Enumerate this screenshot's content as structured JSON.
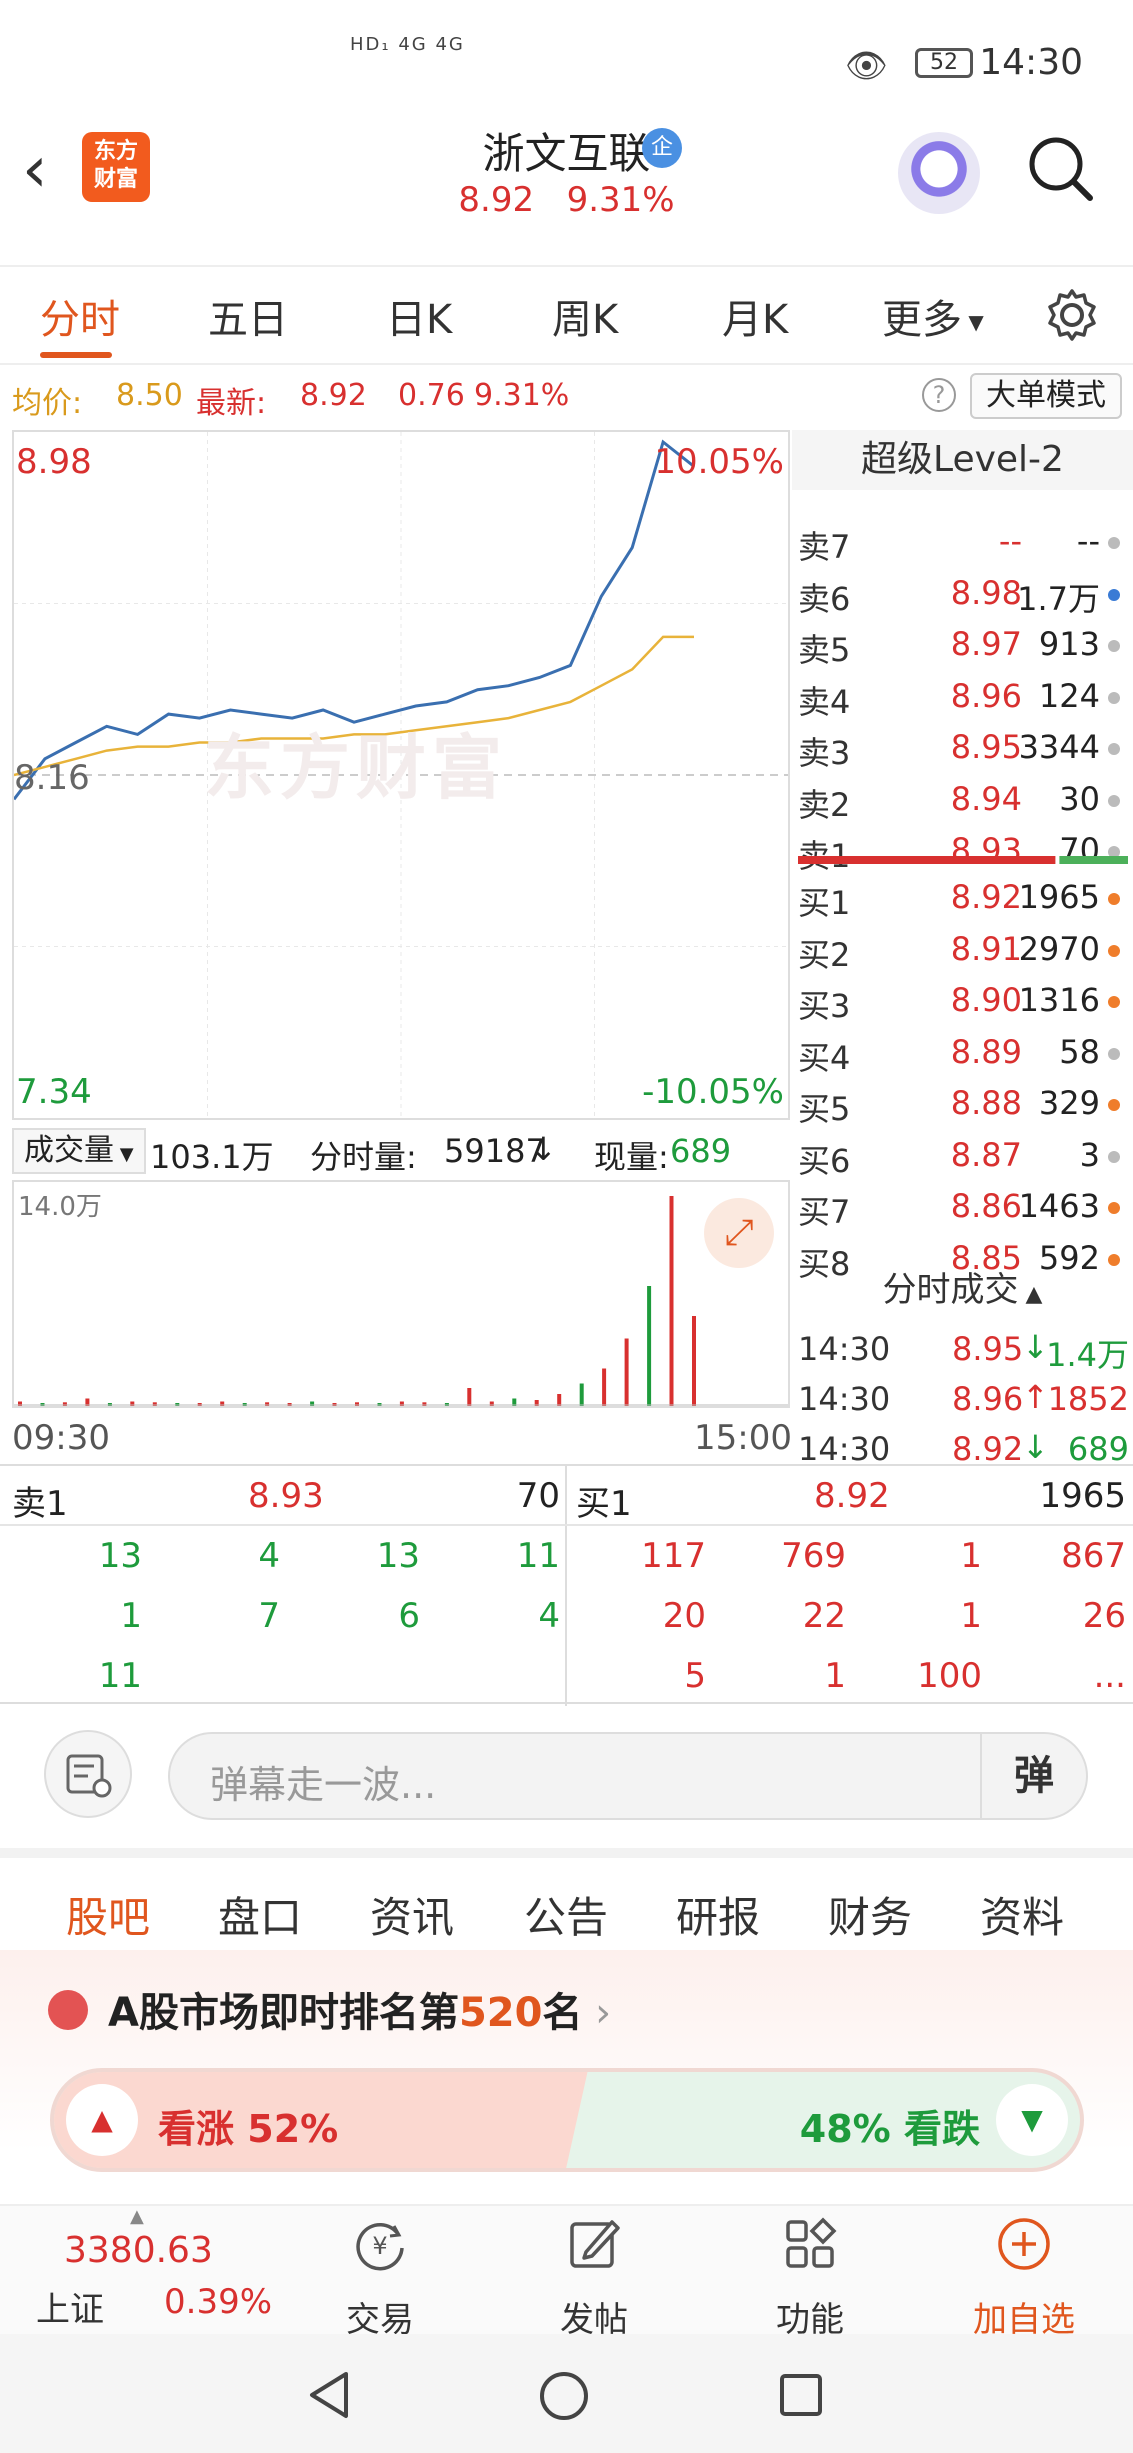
{
  "status_bar": {
    "signal_text": "HD₁ 4G 4G",
    "battery": "52",
    "time": "14:30"
  },
  "header": {
    "logo_text": "东方财富",
    "stock_name": "浙文互联",
    "badge": "企",
    "price": "8.92",
    "change_pct": "9.31%"
  },
  "tabs": [
    "分时",
    "五日",
    "日K",
    "周K",
    "月K",
    "更多"
  ],
  "info_row": {
    "avg_label": "均价:",
    "avg_value": "8.50",
    "latest_label": "最新:",
    "latest_value": "8.92",
    "change": "0.76",
    "change_pct": "9.31%",
    "help": "?",
    "big_order_mode": "大单模式"
  },
  "chart_data": {
    "type": "line",
    "series": [
      {
        "name": "最新",
        "values": [
          8.1,
          8.2,
          8.24,
          8.28,
          8.26,
          8.31,
          8.3,
          8.32,
          8.31,
          8.3,
          8.32,
          8.29,
          8.31,
          8.33,
          8.34,
          8.37,
          8.38,
          8.4,
          8.43,
          8.6,
          8.72,
          8.98,
          8.92
        ]
      },
      {
        "name": "均价",
        "values": [
          8.16,
          8.18,
          8.2,
          8.22,
          8.23,
          8.23,
          8.24,
          8.24,
          8.25,
          8.25,
          8.25,
          8.26,
          8.26,
          8.27,
          8.28,
          8.29,
          8.3,
          8.32,
          8.34,
          8.38,
          8.42,
          8.5,
          8.5
        ]
      }
    ],
    "ylim": [
      7.34,
      8.98
    ],
    "y_max_label": "8.98",
    "y_mid_label": "8.16",
    "y_min_label": "7.34",
    "pct_max_label": "10.05%",
    "pct_min_label": "-10.05%",
    "x_start": "09:30",
    "x_end": "15:00",
    "watermark": "东方财富",
    "volume": {
      "label": "成交量",
      "total": "103.1万",
      "minute_label": "分时量:",
      "minute_value": "59187",
      "current_label": "现量:",
      "current_value": "689",
      "y_max_label": "14.0万",
      "bars": [
        0.3,
        0.2,
        0.25,
        0.5,
        0.2,
        0.3,
        0.25,
        0.2,
        0.2,
        0.3,
        0.2,
        0.25,
        0.2,
        0.3,
        0.2,
        0.25,
        0.2,
        0.3,
        0.25,
        0.2,
        1.2,
        0.3,
        0.5,
        0.4,
        0.8,
        1.5,
        2.5,
        4.5,
        8,
        14,
        6
      ]
    }
  },
  "order_book": {
    "title": "超级Level-2",
    "sells": [
      {
        "label": "卖7",
        "price": "--",
        "qty": "--",
        "dot": "#bbbbbb"
      },
      {
        "label": "卖6",
        "price": "8.98",
        "qty": "1.7万",
        "dot": "#3a7bd5"
      },
      {
        "label": "卖5",
        "price": "8.97",
        "qty": "913",
        "dot": "#bbbbbb"
      },
      {
        "label": "卖4",
        "price": "8.96",
        "qty": "124",
        "dot": "#bbbbbb"
      },
      {
        "label": "卖3",
        "price": "8.95",
        "qty": "3344",
        "dot": "#bbbbbb"
      },
      {
        "label": "卖2",
        "price": "8.94",
        "qty": "30",
        "dot": "#bbbbbb"
      },
      {
        "label": "卖1",
        "price": "8.93",
        "qty": "70",
        "dot": "#bbbbbb"
      }
    ],
    "buys": [
      {
        "label": "买1",
        "price": "8.92",
        "qty": "1965",
        "dot": "#ef7d2b"
      },
      {
        "label": "买2",
        "price": "8.91",
        "qty": "2970",
        "dot": "#ef7d2b"
      },
      {
        "label": "买3",
        "price": "8.90",
        "qty": "1316",
        "dot": "#ef7d2b"
      },
      {
        "label": "买4",
        "price": "8.89",
        "qty": "58",
        "dot": "#bbbbbb"
      },
      {
        "label": "买5",
        "price": "8.88",
        "qty": "329",
        "dot": "#ef7d2b"
      },
      {
        "label": "买6",
        "price": "8.87",
        "qty": "3",
        "dot": "#bbbbbb"
      },
      {
        "label": "买7",
        "price": "8.86",
        "qty": "1463",
        "dot": "#ef7d2b"
      },
      {
        "label": "买8",
        "price": "8.85",
        "qty": "592",
        "dot": "#ef7d2b"
      }
    ],
    "buy_sell_ratio": 0.78
  },
  "ticks": {
    "title": "分时成交",
    "rows": [
      {
        "time": "14:30",
        "price": "8.95",
        "dir": "↓",
        "qty": "1.4万",
        "dir_color": "#1e9b3c"
      },
      {
        "time": "14:30",
        "price": "8.96",
        "dir": "↑",
        "qty": "1852",
        "dir_color": "#d8302f"
      },
      {
        "time": "14:30",
        "price": "8.92",
        "dir": "↓",
        "qty": "689",
        "dir_color": "#1e9b3c"
      }
    ]
  },
  "levels": {
    "sell": {
      "label": "卖1",
      "price": "8.93",
      "qty": "70",
      "rows": [
        [
          "13",
          "4",
          "13",
          "11"
        ],
        [
          "1",
          "7",
          "6",
          "4"
        ],
        [
          "11",
          "",
          "",
          ""
        ]
      ]
    },
    "buy": {
      "label": "买1",
      "price": "8.92",
      "qty": "1965",
      "rows": [
        [
          "117",
          "769",
          "1",
          "867"
        ],
        [
          "20",
          "22",
          "1",
          "26"
        ],
        [
          "5",
          "1",
          "100",
          "..."
        ]
      ]
    }
  },
  "danmaku": {
    "placeholder": "弹幕走一波...",
    "button": "弹"
  },
  "sub_tabs": [
    "股吧",
    "盘口",
    "资讯",
    "公告",
    "研报",
    "财务",
    "资料"
  ],
  "rank": {
    "prefix": "A股市场即时排名第",
    "number": "520",
    "suffix": "名"
  },
  "vote": {
    "up_label": "看涨",
    "up_pct": "52%",
    "down_label": "看跌",
    "down_pct": "48%",
    "up_ratio": 0.52
  },
  "bottom_nav": {
    "index_value": "3380.63",
    "index_name": "上证",
    "index_pct": "0.39%",
    "items": [
      {
        "label": "交易",
        "icon": "yen-cycle-icon"
      },
      {
        "label": "发帖",
        "icon": "edit-icon"
      },
      {
        "label": "功能",
        "icon": "grid-icon"
      },
      {
        "label": "加自选",
        "icon": "plus-circle-icon"
      }
    ]
  },
  "colors": {
    "up": "#d8302f",
    "down": "#1e9b3c",
    "accent": "#e0561e",
    "price_line": "#3a6fb0",
    "avg_line": "#e8b33a"
  }
}
